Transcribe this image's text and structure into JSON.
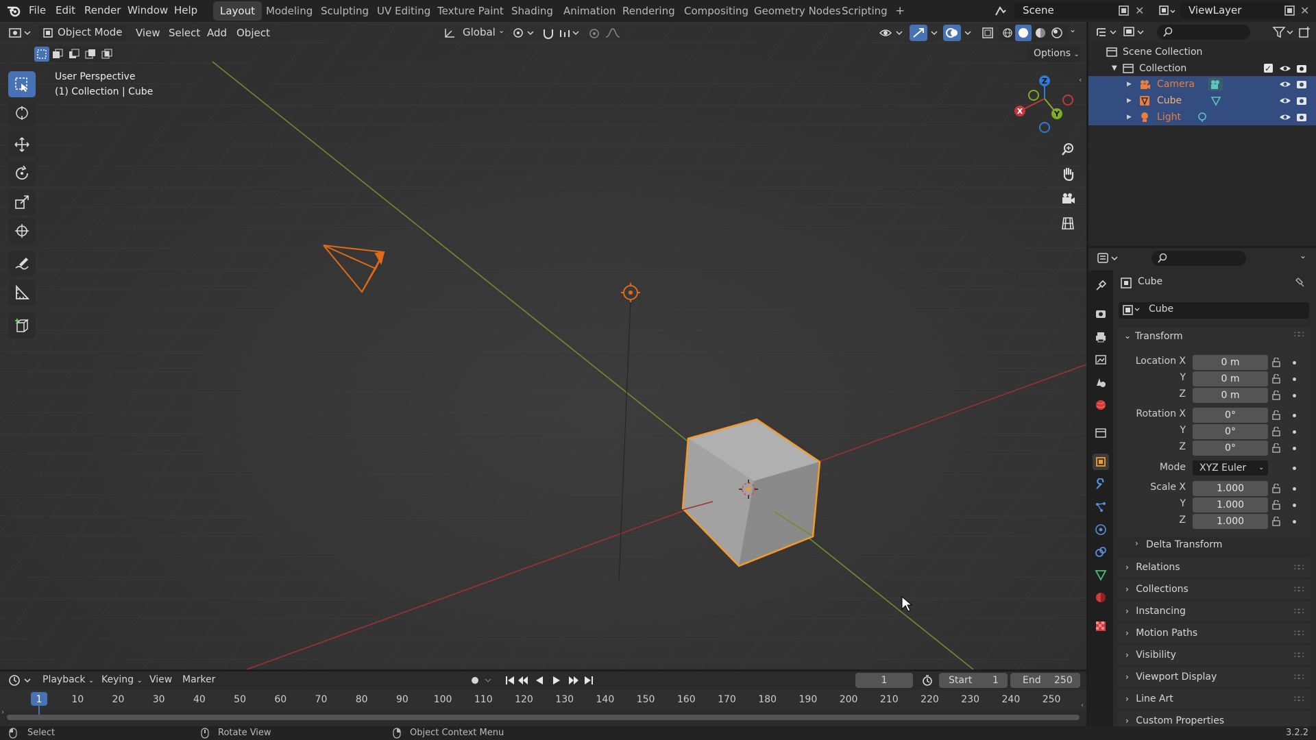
{
  "menu": {
    "items": [
      "File",
      "Edit",
      "Render",
      "Window",
      "Help"
    ]
  },
  "workspaces": {
    "tabs": [
      "Layout",
      "Modeling",
      "Sculpting",
      "UV Editing",
      "Texture Paint",
      "Shading",
      "Animation",
      "Rendering",
      "Compositing",
      "Geometry Nodes",
      "Scripting"
    ],
    "active": "Layout",
    "add": "+"
  },
  "scene": {
    "name": "Scene"
  },
  "view_layer": {
    "name": "ViewLayer"
  },
  "viewport_header": {
    "mode": "Object Mode",
    "view": "View",
    "select": "Select",
    "add": "Add",
    "object": "Object",
    "orientation": "Global",
    "options": "Options"
  },
  "viewport_overlay": {
    "perspective": "User Perspective",
    "collection_info": "(1) Collection | Cube"
  },
  "gizmo": {
    "x": "X",
    "y": "Y",
    "z": "Z"
  },
  "outliner": {
    "root": "Scene Collection",
    "collection": "Collection",
    "items": [
      {
        "name": "Camera",
        "color": "#e97e3d"
      },
      {
        "name": "Cube",
        "color": "#e97e3d"
      },
      {
        "name": "Light",
        "color": "#e97e3d"
      }
    ]
  },
  "properties": {
    "object_name": "Cube",
    "datablock_name": "Cube",
    "transform_title": "Transform",
    "location": {
      "label": "Location X",
      "x": "0 m",
      "y": "0 m",
      "z": "0 m"
    },
    "rotation": {
      "label": "Rotation X",
      "x": "0°",
      "y": "0°",
      "z": "0°"
    },
    "mode": {
      "label": "Mode",
      "value": "XYZ Euler"
    },
    "scale": {
      "label": "Scale X",
      "x": "1.000",
      "y": "1.000",
      "z": "1.000"
    },
    "axis_y": "Y",
    "axis_z": "Z",
    "delta_transform": "Delta Transform",
    "panels": [
      "Relations",
      "Collections",
      "Instancing",
      "Motion Paths",
      "Visibility",
      "Viewport Display",
      "Line Art",
      "Custom Properties"
    ]
  },
  "timeline": {
    "playback": "Playback",
    "keying": "Keying",
    "view": "View",
    "marker": "Marker",
    "current_frame": "1",
    "start_label": "Start",
    "start": "1",
    "end_label": "End",
    "end": "250",
    "ticks": [
      "1",
      "10",
      "20",
      "30",
      "40",
      "50",
      "60",
      "70",
      "80",
      "90",
      "100",
      "110",
      "120",
      "130",
      "140",
      "150",
      "160",
      "170",
      "180",
      "190",
      "200",
      "210",
      "220",
      "230",
      "240",
      "250"
    ]
  },
  "statusbar": {
    "select": "Select",
    "rotate": "Rotate View",
    "context": "Object Context Menu",
    "version": "3.2.2"
  },
  "colors": {
    "accent": "#4772b3",
    "selection_orange": "#f39a2b",
    "axis_x": "#c0393b",
    "axis_y": "#7fae26",
    "axis_z": "#2f7bd6"
  }
}
